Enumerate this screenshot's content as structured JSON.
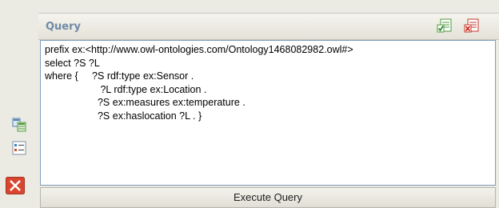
{
  "panel": {
    "title": "Query",
    "header_icons": [
      "validate-query-icon",
      "delete-query-icon"
    ]
  },
  "query": {
    "lines": [
      "prefix ex:<http://www.owl-ontologies.com/Ontology1468082982.owl#>",
      "select ?S ?L",
      "where {     ?S rdf:type ex:Sensor .",
      "                    ?L rdf:type ex:Location .",
      "                   ?S ex:measures ex:temperature .",
      "                   ?S ex:haslocation ?L . }"
    ]
  },
  "execute_button": {
    "label": "Execute Query"
  },
  "left_icons": [
    "table-view-icon",
    "list-view-icon",
    "close-icon"
  ]
}
